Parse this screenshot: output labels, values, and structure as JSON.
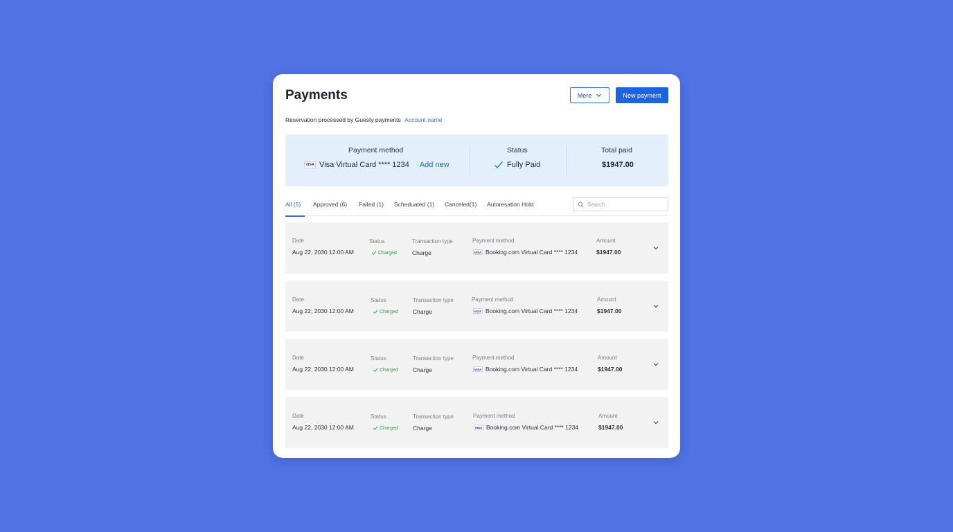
{
  "page": {
    "title": "Payments"
  },
  "header": {
    "more_label": "Mere",
    "new_payment_label": "New payment"
  },
  "subline": {
    "text": "Reservation processed by Guesty payments",
    "account_link": "Account name"
  },
  "summary": {
    "payment_method_label": "Payment method",
    "payment_method_brand": "VISA",
    "payment_method_value": "Visa Virtual Card **** 1234",
    "add_new_label": "Add new",
    "status_label": "Status",
    "status_value": "Fully Paid",
    "total_label": "Total paid",
    "total_value": "$1947.00"
  },
  "tabs": [
    {
      "label": "All (5)",
      "active": true
    },
    {
      "label": "Approved (6)"
    },
    {
      "label": "Failed (1)"
    },
    {
      "label": "Scheduated (1)"
    },
    {
      "label": "Canceled(1)"
    },
    {
      "label": "Autoresation Hold"
    }
  ],
  "search": {
    "placeholder": "Search"
  },
  "columns": {
    "date": "Date",
    "status": "Status",
    "type": "Transaction type",
    "method": "Payment method",
    "amount": "Amount"
  },
  "rows": [
    {
      "date": "Aug 22, 2030 12:00 AM",
      "status": "Charged",
      "type": "Charge",
      "brand": "VISA",
      "method": "Booking.com Virtual Card **** 1234",
      "amount": "$1947.00"
    },
    {
      "date": "Aug 22, 2030 12:00 AM",
      "status": "Charged",
      "type": "Charge",
      "brand": "VISA",
      "method": "Booking.com Virtual Card **** 1234",
      "amount": "$1947.00"
    },
    {
      "date": "Aug 22, 2030 12:00 AM",
      "status": "Charged",
      "type": "Charge",
      "brand": "VISA",
      "method": "Booking.com Virtual Card **** 1234",
      "amount": "$1947.00"
    },
    {
      "date": "Aug 22, 2030 12:00 AM",
      "status": "Charged",
      "type": "Charge",
      "brand": "VISA",
      "method": "Booking.com Virtual Card **** 1234",
      "amount": "$1947.00"
    }
  ],
  "colors": {
    "background": "#5072e3",
    "accent": "#1d63dd",
    "summary_bg": "#e3f0fc",
    "charged_green": "#2e9a47"
  },
  "icons": {
    "more": "chevron-down-icon",
    "status_ok": "check-icon",
    "search": "search-icon",
    "row_expand": "chevron-down-icon"
  }
}
